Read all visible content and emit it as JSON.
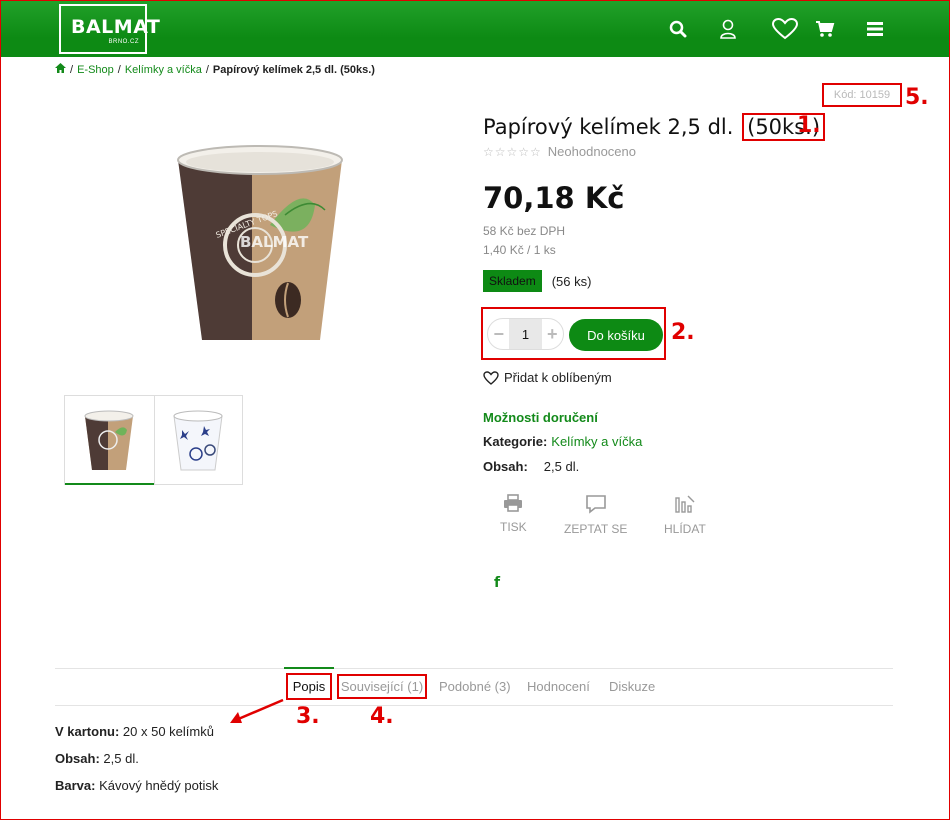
{
  "header": {
    "logo_main": "BALMAT",
    "logo_sub": "BRNO.CZ",
    "icons": [
      "search-icon",
      "user-icon",
      "heart-icon",
      "cart-icon",
      "menu-icon"
    ],
    "brand_color": "#0d8a14"
  },
  "breadcrumb": {
    "items": [
      "E-Shop",
      "Kelímky a víčka"
    ],
    "current": "Papírový kelímek 2,5 dl. (50ks.)"
  },
  "product": {
    "code": "Kód: 10159",
    "title_main": "Papírový kelímek 2,5 dl.",
    "title_box": "(50ks.)",
    "rating_text": "Neohodnoceno",
    "price": "70,18 Kč",
    "price_without_vat": "58 Kč bez DPH",
    "unit_price": "1,40 Kč / 1 ks",
    "stock_label": "Skladem",
    "stock_count": "(56 ks)",
    "quantity": "1",
    "add_to_cart": "Do košíku",
    "add_favorite": "Přidat k oblíbeným",
    "delivery_options": "Možnosti doručení",
    "category_label": "Kategorie:",
    "category_value": "Kelímky a víčka",
    "content_label": "Obsah:",
    "content_value": "2,5 dl.",
    "cup_print": "SPECIALTY TOPS",
    "cup_logo": "BALMAT",
    "actions": [
      {
        "label": "TISK",
        "icon": "printer-icon"
      },
      {
        "label": "ZEPTAT SE",
        "icon": "chat-icon"
      },
      {
        "label": "HLÍDAT",
        "icon": "chart-watch-icon"
      }
    ],
    "social": "f"
  },
  "tabs": [
    {
      "label": "Popis",
      "active": true
    },
    {
      "label": "Související (1)"
    },
    {
      "label": "Podobné (3)"
    },
    {
      "label": "Hodnocení"
    },
    {
      "label": "Diskuze"
    }
  ],
  "description": [
    {
      "label": "V kartonu:",
      "value": "20 x 50 kelímků"
    },
    {
      "label": "Obsah:",
      "value": "2,5 dl."
    },
    {
      "label": "Barva:",
      "value": "Kávový hnědý potisk"
    }
  ],
  "annotations": [
    "1.",
    "2.",
    "3.",
    "4.",
    "5."
  ],
  "annotation_color": "#e00000"
}
